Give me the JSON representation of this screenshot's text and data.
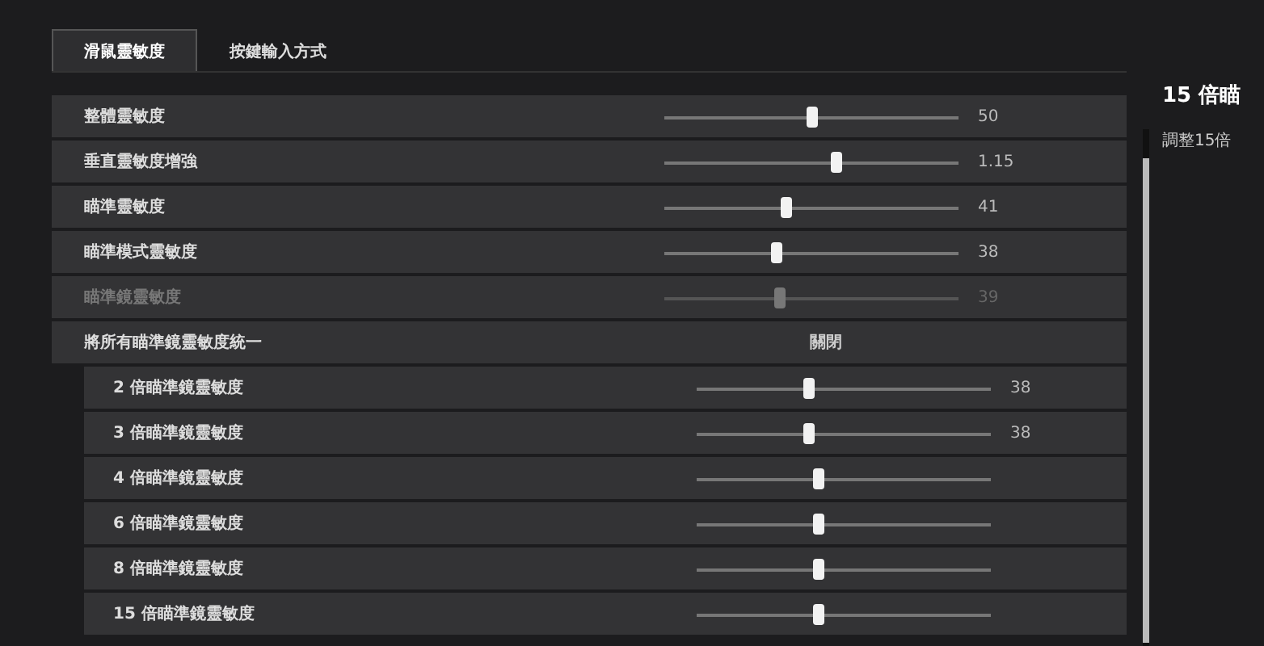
{
  "tabs": [
    {
      "label": "滑鼠靈敏度",
      "selected": true
    },
    {
      "label": "按鍵輸入方式",
      "selected": false
    }
  ],
  "settings": [
    {
      "kind": "slider",
      "name": "整體靈敏度",
      "level": 0.5,
      "reading": "50",
      "disabled": false
    },
    {
      "kind": "slider",
      "name": "垂直靈敏度增強",
      "level": 0.58,
      "reading": "1.15",
      "disabled": false
    },
    {
      "kind": "slider",
      "name": "瞄準靈敏度",
      "level": 0.41,
      "reading": "41",
      "disabled": false
    },
    {
      "kind": "slider",
      "name": "瞄準模式靈敏度",
      "level": 0.38,
      "reading": "38",
      "disabled": false
    },
    {
      "kind": "slider",
      "name": "瞄準鏡靈敏度",
      "level": 0.39,
      "reading": "39",
      "disabled": true
    },
    {
      "kind": "toggle",
      "name": "將所有瞄準鏡靈敏度統一",
      "value": "關閉",
      "disabled": false,
      "children": [
        {
          "kind": "slider",
          "name": "2 倍瞄準鏡靈敏度",
          "level": 0.38,
          "reading": "38",
          "disabled": false
        },
        {
          "kind": "slider",
          "name": "3 倍瞄準鏡靈敏度",
          "level": 0.38,
          "reading": "38",
          "disabled": false
        },
        {
          "kind": "slider",
          "name": "4 倍瞄準鏡靈敏度",
          "level": 0.41,
          "disabled": false
        },
        {
          "kind": "slider",
          "name": "6 倍瞄準鏡靈敏度",
          "level": 0.41,
          "disabled": false
        },
        {
          "kind": "slider",
          "name": "8 倍瞄準鏡靈敏度",
          "level": 0.41,
          "disabled": false
        },
        {
          "kind": "slider",
          "name": "15 倍瞄準鏡靈敏度",
          "level": 0.41,
          "disabled": false
        }
      ]
    }
  ],
  "detail": {
    "title": "15 倍瞄",
    "description": "調整15倍"
  }
}
